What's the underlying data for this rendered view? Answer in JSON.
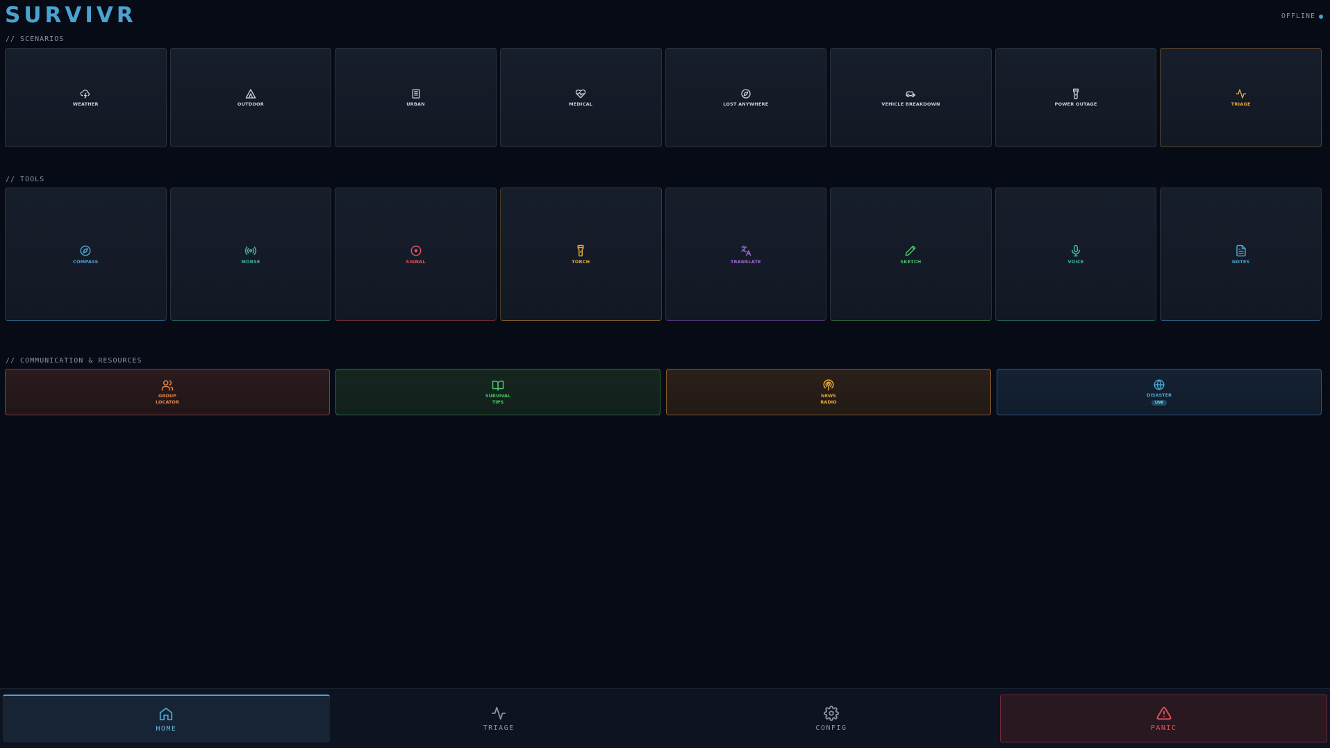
{
  "app": {
    "title": "SURVIVR",
    "status": "OFFLINE",
    "status_color": "#4aa3cf"
  },
  "sections": {
    "scenarios": "// SCENARIOS",
    "tools": "// TOOLS",
    "comms": "// COMMUNICATION & RESOURCES"
  },
  "scenarios": [
    {
      "label": "WEATHER",
      "icon": "cloud-lightning-icon",
      "color": "#c9d1dc"
    },
    {
      "label": "OUTDOOR",
      "icon": "tent-icon",
      "color": "#c9d1dc"
    },
    {
      "label": "URBAN",
      "icon": "building-icon",
      "color": "#c9d1dc"
    },
    {
      "label": "MEDICAL",
      "icon": "heart-pulse-icon",
      "color": "#c9d1dc"
    },
    {
      "label": "LOST ANYWHERE",
      "icon": "compass-icon",
      "color": "#c9d1dc"
    },
    {
      "label": "VEHICLE BREAKDOWN",
      "icon": "car-icon",
      "color": "#c9d1dc"
    },
    {
      "label": "POWER OUTAGE",
      "icon": "flashlight-icon",
      "color": "#c9d1dc"
    },
    {
      "label": "TRIAGE",
      "icon": "activity-icon",
      "color": "#e6a93a"
    }
  ],
  "tools": [
    {
      "label": "COMPASS",
      "icon": "compass-icon",
      "color": "#4aa3cf"
    },
    {
      "label": "MORSE",
      "icon": "radio-waves-icon",
      "color": "#3fb8a8"
    },
    {
      "label": "SIGNAL",
      "icon": "target-icon",
      "color": "#e2545f"
    },
    {
      "label": "TORCH",
      "icon": "flashlight-icon",
      "color": "#e6a93a"
    },
    {
      "label": "TRANSLATE",
      "icon": "languages-icon",
      "color": "#a06cd8"
    },
    {
      "label": "SKETCH",
      "icon": "pencil-icon",
      "color": "#4cc46a"
    },
    {
      "label": "VOICE",
      "icon": "microphone-icon",
      "color": "#3fb8a8"
    },
    {
      "label": "NOTES",
      "icon": "file-text-icon",
      "color": "#4aa3cf"
    }
  ],
  "comms": [
    {
      "line1": "GROUP",
      "line2": "LOCATOR",
      "icon": "users-icon",
      "color": "#e8844a",
      "badge": ""
    },
    {
      "line1": "SURVIVAL",
      "line2": "TIPS",
      "icon": "book-open-icon",
      "color": "#4cc46a",
      "badge": ""
    },
    {
      "line1": "NEWS",
      "line2": "RADIO",
      "icon": "podcast-icon",
      "color": "#e6a93a",
      "badge": ""
    },
    {
      "line1": "DISASTER",
      "line2": "",
      "icon": "globe-icon",
      "color": "#4aa3cf",
      "badge": "LIVE"
    }
  ],
  "nav": [
    {
      "label": "HOME",
      "icon": "home-icon"
    },
    {
      "label": "TRIAGE",
      "icon": "activity-icon"
    },
    {
      "label": "CONFIG",
      "icon": "gear-icon"
    },
    {
      "label": "PANIC",
      "icon": "alert-triangle-icon"
    }
  ]
}
